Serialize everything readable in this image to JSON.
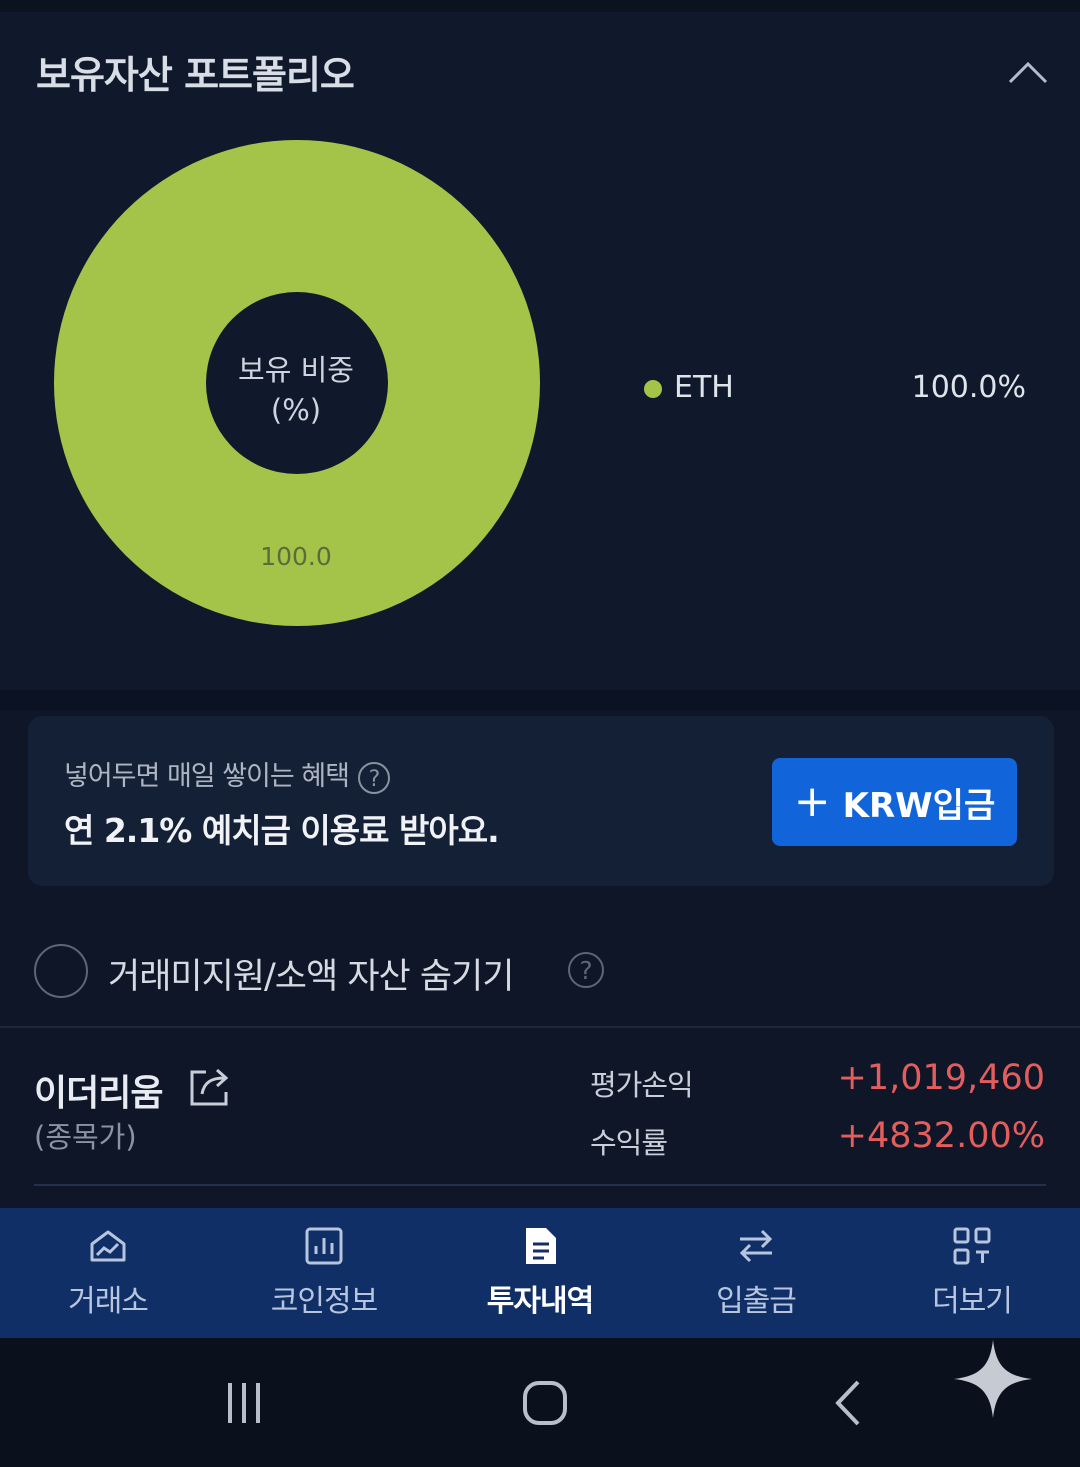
{
  "portfolio": {
    "title": "보유자산 포트폴리오",
    "center_label_line1": "보유 비중",
    "center_label_line2": "(%)",
    "slice_label": "100.0",
    "legend": [
      {
        "name": "ETH",
        "value": "100.0%",
        "color": "#a4c449"
      }
    ],
    "collapse_icon": "chevron-up-icon"
  },
  "chart_data": {
    "type": "pie",
    "categories": [
      "ETH"
    ],
    "values": [
      100.0
    ],
    "colors": [
      "#a4c449"
    ],
    "donut": true,
    "title": "",
    "legend_placement": "right"
  },
  "promo": {
    "subtitle": "넣어두면 매일 쌓이는 혜택",
    "headline": "연 2.1% 예치금 이용료 받아요.",
    "button_label": "KRW입금",
    "button_color": "#1264db"
  },
  "filter": {
    "hide_label": "거래미지원/소액 자산 숨기기",
    "checked": false
  },
  "holding": {
    "name": "이더리움",
    "sub": "(종목가)",
    "pnl_label": "평가손익",
    "pnl_value": "+1,019,460",
    "return_label": "수익률",
    "return_value": "+4832.00%",
    "positive_color": "#e45d5d"
  },
  "bottom_nav": {
    "items": [
      {
        "label": "거래소",
        "icon": "chart-house-icon",
        "active": false
      },
      {
        "label": "코인정보",
        "icon": "bar-chart-icon",
        "active": false
      },
      {
        "label": "투자내역",
        "icon": "document-icon",
        "active": true
      },
      {
        "label": "입출금",
        "icon": "transfer-arrows-icon",
        "active": false
      },
      {
        "label": "더보기",
        "icon": "grid-more-icon",
        "active": false
      }
    ]
  },
  "system_nav": {
    "buttons": [
      "recent-apps-icon",
      "home-icon",
      "back-icon"
    ]
  }
}
